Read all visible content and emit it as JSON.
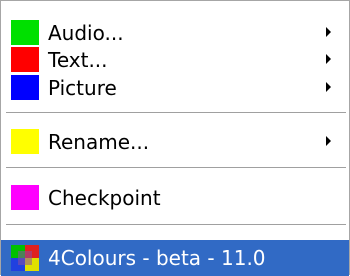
{
  "menu": {
    "items": [
      {
        "label": "Audio...",
        "color": "#00e000",
        "submenu": true
      },
      {
        "label": "Text...",
        "color": "#ff0000",
        "submenu": true
      },
      {
        "label": "Picture",
        "color": "#0000ff",
        "submenu": true
      },
      {
        "label": "Rename...",
        "color": "#ffff00",
        "submenu": true
      },
      {
        "label": "Checkpoint",
        "color": "#ff00ff",
        "submenu": false
      }
    ],
    "footer": {
      "label": "4Colours - beta - 11.0",
      "icon": "four-colours-app-icon",
      "highlight_color": "#316ac5"
    }
  }
}
